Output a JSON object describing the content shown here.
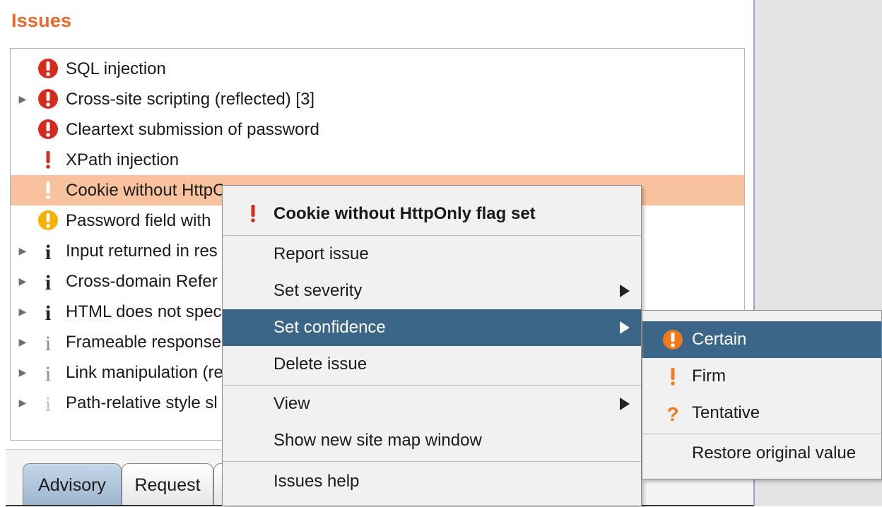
{
  "panel_title": "Issues",
  "issues": [
    {
      "label": "SQL injection",
      "icon": "red-circle-exclamation",
      "expandable": false
    },
    {
      "label": "Cross-site scripting (reflected) [3]",
      "icon": "red-circle-exclamation",
      "expandable": true
    },
    {
      "label": "Cleartext submission of password",
      "icon": "red-circle-exclamation",
      "expandable": false
    },
    {
      "label": "XPath injection",
      "icon": "red-exclamation",
      "expandable": false
    },
    {
      "label": "Cookie without HttpO",
      "icon": "white-exclamation",
      "expandable": false,
      "selected": true
    },
    {
      "label": "Password field with",
      "icon": "yellow-circle-exclamation",
      "expandable": false
    },
    {
      "label": "Input returned in res",
      "icon": "info-dark",
      "expandable": true
    },
    {
      "label": "Cross-domain Refer",
      "icon": "info-dark",
      "expandable": true
    },
    {
      "label": "HTML does not spec",
      "icon": "info-dark",
      "expandable": true
    },
    {
      "label": "Frameable response",
      "icon": "info-light",
      "expandable": true
    },
    {
      "label": "Link manipulation (re",
      "icon": "info-light",
      "expandable": true
    },
    {
      "label": "Path-relative style sl",
      "icon": "info-lighter",
      "expandable": true
    }
  ],
  "tabs": [
    {
      "label": "Advisory",
      "active": true
    },
    {
      "label": "Request",
      "active": false
    }
  ],
  "context_menu": {
    "header": "Cookie without HttpOnly flag set",
    "report_issue": "Report issue",
    "set_severity": "Set severity",
    "set_confidence": "Set confidence",
    "delete_issue": "Delete issue",
    "view": "View",
    "show_site_map": "Show new site map window",
    "issues_help": "Issues help"
  },
  "confidence_submenu": {
    "certain": "Certain",
    "firm": "Firm",
    "tentative": "Tentative",
    "restore": "Restore original value"
  },
  "colors": {
    "title": "#e9692c",
    "selected_row": "#f9c29f",
    "menu_highlight": "#3c6688",
    "high_severity": "#d62a1e",
    "low_severity": "#f5b300",
    "confidence_orange": "#f07a1b"
  }
}
